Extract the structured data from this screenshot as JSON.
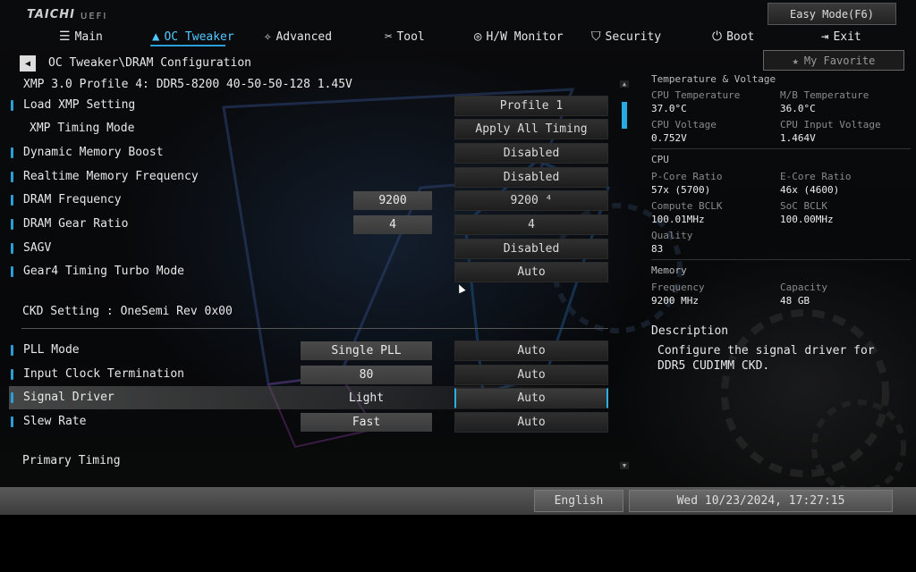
{
  "header": {
    "brand": "TAICHI",
    "uefi": "UEFI",
    "easy_mode": "Easy Mode(F6)",
    "favorite": "My Favorite"
  },
  "nav": [
    {
      "label": "Main",
      "icon": "list-icon",
      "active": false
    },
    {
      "label": "OC Tweaker",
      "icon": "flame-icon",
      "active": true
    },
    {
      "label": "Advanced",
      "icon": "star-icon",
      "active": false
    },
    {
      "label": "Tool",
      "icon": "tools-icon",
      "active": false
    },
    {
      "label": "H/W Monitor",
      "icon": "gauge-icon",
      "active": false
    },
    {
      "label": "Security",
      "icon": "shield-icon",
      "active": false
    },
    {
      "label": "Boot",
      "icon": "power-icon",
      "active": false
    },
    {
      "label": "Exit",
      "icon": "exit-icon",
      "active": false
    }
  ],
  "breadcrumb": "OC Tweaker\\DRAM Configuration",
  "xmp_info": "XMP 3.0 Profile 4: DDR5-8200 40-50-50-128 1.45V",
  "settings": [
    {
      "label": "Load XMP Setting",
      "value": "Profile 1"
    },
    {
      "label": "XMP Timing Mode",
      "value": "Apply All Timing"
    },
    {
      "label": "Dynamic Memory Boost",
      "value": "Disabled"
    },
    {
      "label": "Realtime Memory Frequency",
      "value": "Disabled"
    },
    {
      "label": "DRAM Frequency",
      "field": "9200",
      "value": "9200 ⁴"
    },
    {
      "label": "DRAM Gear Ratio",
      "field": "4",
      "value": "4"
    },
    {
      "label": "SAGV",
      "value": "Disabled"
    },
    {
      "label": "Gear4 Timing Turbo Mode",
      "value": "Auto"
    }
  ],
  "ckd_setting": "CKD Setting : OneSemi Rev 0x00",
  "ckd_settings": [
    {
      "label": "PLL Mode",
      "field": "Single PLL",
      "value": "Auto"
    },
    {
      "label": "Input Clock Termination",
      "field": "80",
      "value": "Auto"
    },
    {
      "label": "Signal Driver",
      "field": "Light",
      "value": "Auto",
      "selected": true
    },
    {
      "label": "Slew Rate",
      "field": "Fast",
      "value": "Auto"
    }
  ],
  "primary_timing": "Primary Timing",
  "monitor": {
    "temp_voltage_title": "Temperature & Voltage",
    "cpu_temp_label": "CPU Temperature",
    "cpu_temp": "37.0°C",
    "mb_temp_label": "M/B Temperature",
    "mb_temp": "36.0°C",
    "cpu_voltage_label": "CPU Voltage",
    "cpu_voltage": "0.752V",
    "cpu_input_voltage_label": "CPU Input Voltage",
    "cpu_input_voltage": "1.464V",
    "cpu_title": "CPU",
    "pcore_label": "P-Core Ratio",
    "pcore": "57x (5700)",
    "ecore_label": "E-Core Ratio",
    "ecore": "46x (4600)",
    "compute_bclk_label": "Compute BCLK",
    "compute_bclk": "100.01MHz",
    "soc_bclk_label": "SoC BCLK",
    "soc_bclk": "100.00MHz",
    "quality_label": "Quality",
    "quality": "83",
    "memory_title": "Memory",
    "freq_label": "Frequency",
    "freq": "9200 MHz",
    "capacity_label": "Capacity",
    "capacity": "48 GB"
  },
  "description": {
    "title": "Description",
    "text": "Configure the signal driver for DDR5 CUDIMM CKD."
  },
  "footer": {
    "language": "English",
    "datetime": "Wed 10/23/2024, 17:27:15"
  },
  "colors": {
    "accent": "#2a9fd6",
    "active_nav": "#52c7ff"
  }
}
